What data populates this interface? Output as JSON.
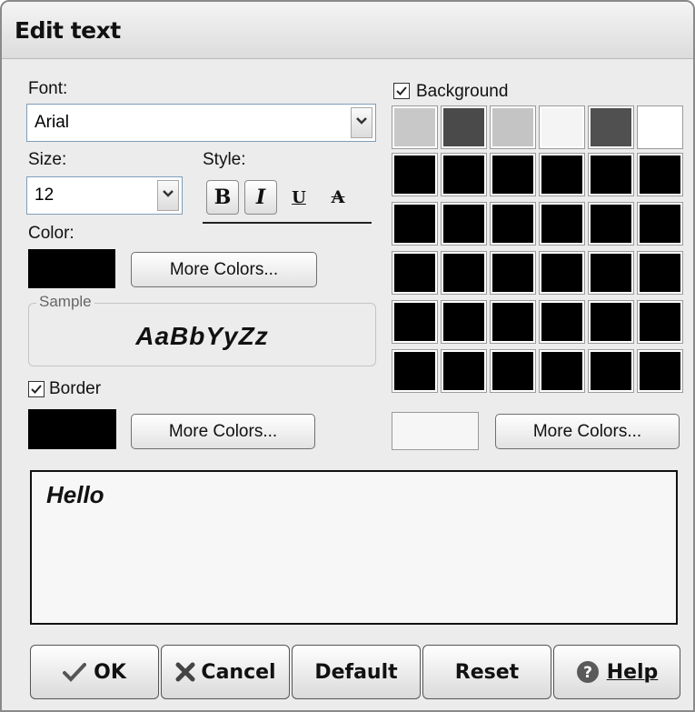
{
  "window": {
    "title": "Edit text"
  },
  "font": {
    "label": "Font:",
    "value": "Arial",
    "arrow_icon": "chevron-down-icon"
  },
  "size": {
    "label": "Size:",
    "value": "12",
    "arrow_icon": "chevron-down-icon"
  },
  "style": {
    "label": "Style:",
    "buttons": [
      {
        "name": "bold",
        "glyph": "B",
        "active": true
      },
      {
        "name": "italic",
        "glyph": "I",
        "active": true
      },
      {
        "name": "underline",
        "glyph": "U",
        "active": false
      },
      {
        "name": "strikethrough",
        "glyph": "A",
        "active": false
      }
    ]
  },
  "color": {
    "label": "Color:",
    "swatch": "#000000",
    "more_label": "More Colors..."
  },
  "sample": {
    "legend": "Sample",
    "text": "AaBbYyZz"
  },
  "border": {
    "label": "Border",
    "checked": true,
    "swatch": "#000000",
    "more_label": "More Colors..."
  },
  "background": {
    "label": "Background",
    "checked": true,
    "palette_row1": [
      "#c8c8c8",
      "#4a4a4a",
      "#c4c4c4",
      "#f4f4f4",
      "#505050",
      "#ffffff"
    ],
    "palette_fill": "#000000",
    "selected_swatch": "#f6f6f6",
    "more_label": "More Colors..."
  },
  "editor": {
    "text": "Hello"
  },
  "buttons": {
    "ok": {
      "label": "OK",
      "icon": "check-icon"
    },
    "cancel": {
      "label": "Cancel",
      "icon": "x-icon"
    },
    "default": {
      "label": "Default"
    },
    "reset": {
      "label": "Reset"
    },
    "help": {
      "label": "Help",
      "icon": "help-icon"
    }
  }
}
